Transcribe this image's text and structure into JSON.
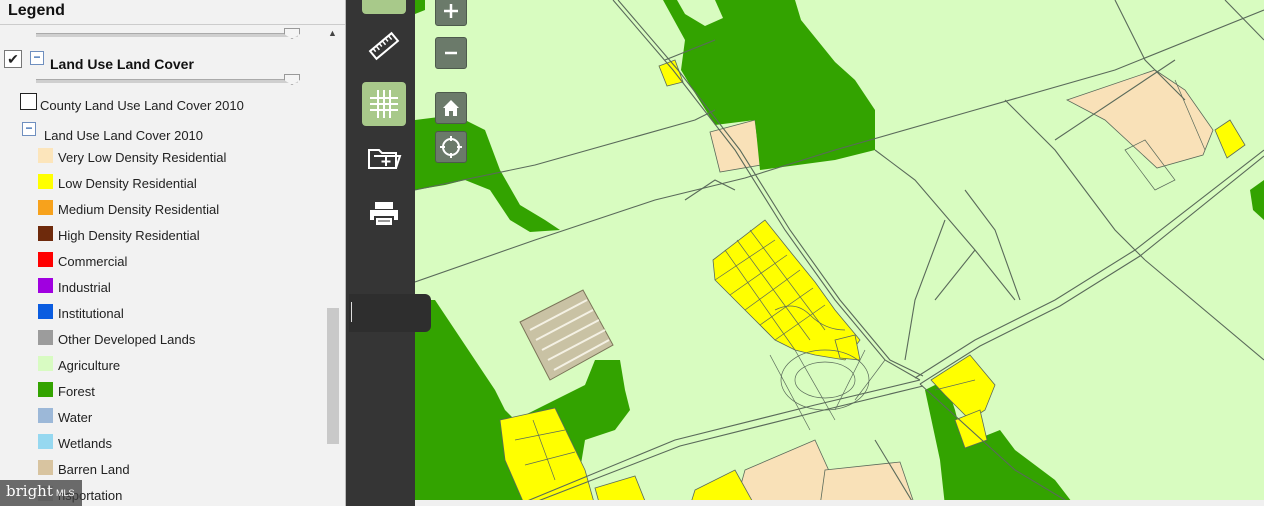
{
  "legend": {
    "title": "Legend",
    "layer": {
      "name": "Land Use Land Cover",
      "checked": "✔"
    },
    "sublayers": {
      "county": "County Land Use Land Cover 2010",
      "group": "Land Use Land Cover 2010"
    },
    "items": [
      {
        "label": "Very Low Density Residential",
        "color": "#fce5bb"
      },
      {
        "label": "Low Density Residential",
        "color": "#ffff00"
      },
      {
        "label": "Medium Density Residential",
        "color": "#f7a21c"
      },
      {
        "label": "High Density Residential",
        "color": "#6e2a0c"
      },
      {
        "label": "Commercial",
        "color": "#ff0000"
      },
      {
        "label": "Industrial",
        "color": "#a000e0"
      },
      {
        "label": "Institutional",
        "color": "#0a5ce0"
      },
      {
        "label": "Other Developed Lands",
        "color": "#9c9c9c"
      },
      {
        "label": "Agriculture",
        "color": "#d8fbc2"
      },
      {
        "label": "Forest",
        "color": "#33a300"
      },
      {
        "label": "Water",
        "color": "#9cb8d8"
      },
      {
        "label": "Wetlands",
        "color": "#96d8f0"
      },
      {
        "label": "Barren Land",
        "color": "#d8c4a0"
      },
      {
        "label": "nsportation",
        "color": "#cfcfcf"
      }
    ]
  },
  "toolbar": {
    "tools": [
      "measure-tool",
      "grid-tool",
      "add-folder-tool",
      "print-tool"
    ]
  },
  "map": {
    "controls": {
      "zoom_in": "+",
      "zoom_out": "−"
    },
    "colors": {
      "agriculture": "#d8fcc0",
      "forest": "#33a300",
      "low_density": "#ffff00",
      "very_low_density": "#f9e1b8",
      "boundary": "#5a6a5a"
    }
  },
  "watermark": {
    "brand": "bright",
    "suffix": "MLS"
  }
}
